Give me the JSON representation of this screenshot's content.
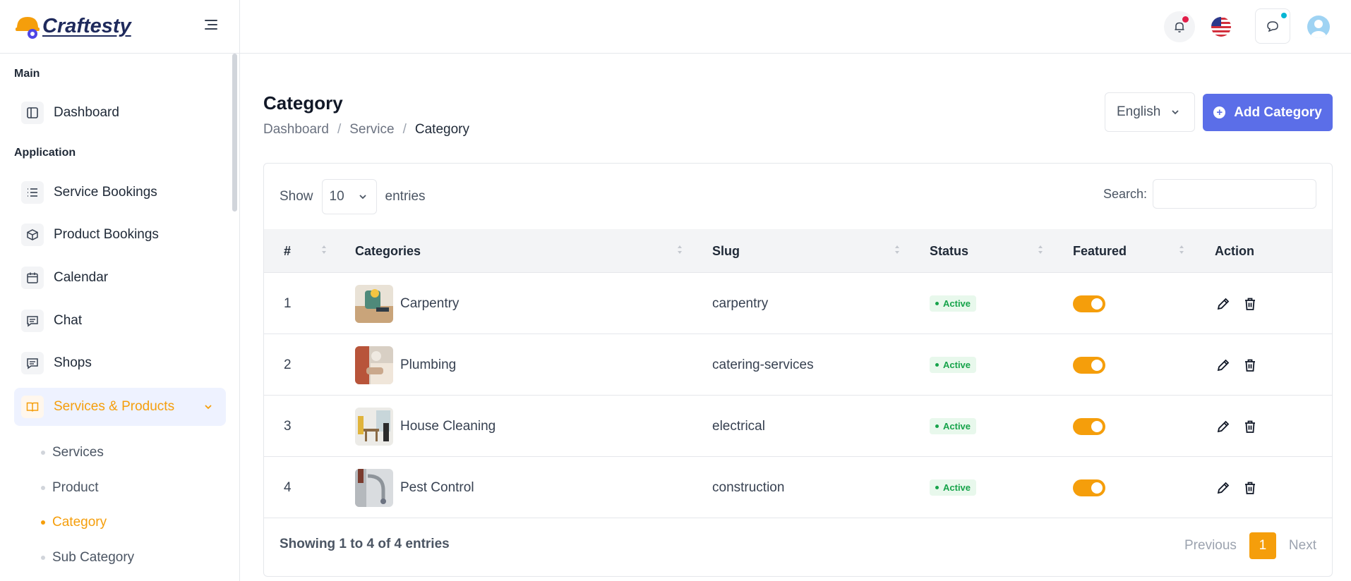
{
  "brand": {
    "name": "Craftesty"
  },
  "sidebar": {
    "section_main": "Main",
    "section_application": "Application",
    "items": [
      {
        "label": "Dashboard",
        "icon": "layout-icon"
      },
      {
        "label": "Service Bookings",
        "icon": "list-icon"
      },
      {
        "label": "Product Bookings",
        "icon": "box-icon"
      },
      {
        "label": "Calendar",
        "icon": "calendar-icon"
      },
      {
        "label": "Chat",
        "icon": "message-icon"
      },
      {
        "label": "Shops",
        "icon": "message-icon"
      },
      {
        "label": "Services & Products",
        "icon": "book-icon"
      }
    ],
    "subitems": [
      {
        "label": "Services"
      },
      {
        "label": "Product"
      },
      {
        "label": "Category"
      },
      {
        "label": "Sub Category"
      }
    ]
  },
  "page": {
    "title": "Category",
    "breadcrumb": [
      "Dashboard",
      "Service",
      "Category"
    ],
    "language": "English",
    "add_label": "Add Category"
  },
  "table": {
    "show_label": "Show",
    "entries_count": "10",
    "entries_label": "entries",
    "search_label": "Search:",
    "headers": [
      "#",
      "Categories",
      "Slug",
      "Status",
      "Featured",
      "Action"
    ],
    "rows": [
      {
        "num": "1",
        "category": "Carpentry",
        "slug": "carpentry",
        "status": "Active"
      },
      {
        "num": "2",
        "category": "Plumbing",
        "slug": "catering-services",
        "status": "Active"
      },
      {
        "num": "3",
        "category": "House Cleaning",
        "slug": "electrical",
        "status": "Active"
      },
      {
        "num": "4",
        "category": "Pest Control",
        "slug": "construction",
        "status": "Active"
      }
    ],
    "info": "Showing 1 to 4 of 4 entries",
    "pagination": {
      "previous": "Previous",
      "current": "1",
      "next": "Next"
    }
  },
  "colors": {
    "accent": "#f59e0b",
    "primary": "#5b6ee8",
    "success": "#16a34a"
  }
}
